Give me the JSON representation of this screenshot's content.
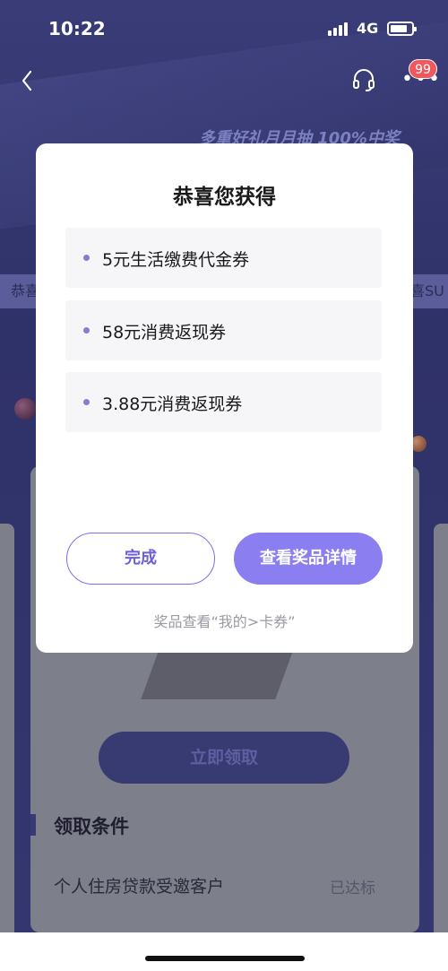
{
  "status_bar": {
    "time": "10:22",
    "network": "4G"
  },
  "nav": {
    "badge_count": "99"
  },
  "background": {
    "slogan": "多重好礼月月抽 100%中奖",
    "chip_left": "恭喜",
    "chip_right": "喜SU",
    "claim_button": "立即领取",
    "section_title": "领取条件",
    "condition_text": "个人住房贷款受邀客户",
    "condition_status": "已达标"
  },
  "dialog": {
    "title": "恭喜您获得",
    "prizes": [
      {
        "label": "5元生活缴费代金券"
      },
      {
        "label": "58元消费返现券"
      },
      {
        "label": "3.88元消费返现券"
      }
    ],
    "done_label": "完成",
    "detail_label": "查看奖品详情",
    "hint": "奖品查看“我的>卡券”"
  },
  "colors": {
    "accent": "#8b7ef0",
    "accent_outline": "#7d70e0",
    "badge": "#f0585e",
    "backdrop": "#2f3268"
  }
}
